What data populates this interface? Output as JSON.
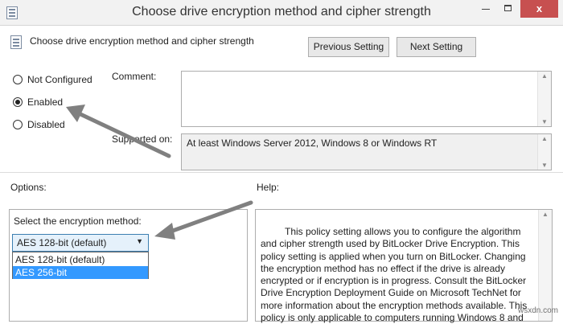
{
  "window": {
    "title": "Choose drive encryption method and cipher strength",
    "controls": {
      "minimize_icon": "minimize-icon",
      "maximize_icon": "maximize-icon",
      "close_glyph": "x"
    }
  },
  "header": {
    "policy_name": "Choose drive encryption method and cipher strength",
    "prev_label": "Previous Setting",
    "next_label": "Next Setting"
  },
  "state": {
    "options": [
      {
        "label": "Not Configured",
        "checked": false
      },
      {
        "label": "Enabled",
        "checked": true
      },
      {
        "label": "Disabled",
        "checked": false
      }
    ]
  },
  "comment": {
    "label": "Comment:",
    "value": ""
  },
  "supported": {
    "label": "Supported on:",
    "value": "At least Windows Server 2012, Windows 8 or Windows RT"
  },
  "options_section": {
    "label": "Options:",
    "select_label": "Select the encryption method:",
    "selected_value": "AES 128-bit (default)",
    "dropdown_options": [
      "AES 128-bit (default)",
      "AES 256-bit"
    ]
  },
  "help": {
    "label": "Help:",
    "text": "This policy setting allows you to configure the algorithm and cipher strength used by BitLocker Drive Encryption. This policy setting is applied when you turn on BitLocker. Changing the encryption method has no effect if the drive is already encrypted or if encryption is in progress. Consult the BitLocker Drive Encryption Deployment Guide on Microsoft TechNet for more information about the encryption methods available. This policy is only applicable to computers running Windows 8 and"
  },
  "watermark": "wsxdn.com",
  "colors": {
    "close_button": "#c75050",
    "highlight": "#3399ff",
    "arrow": "#808080"
  }
}
